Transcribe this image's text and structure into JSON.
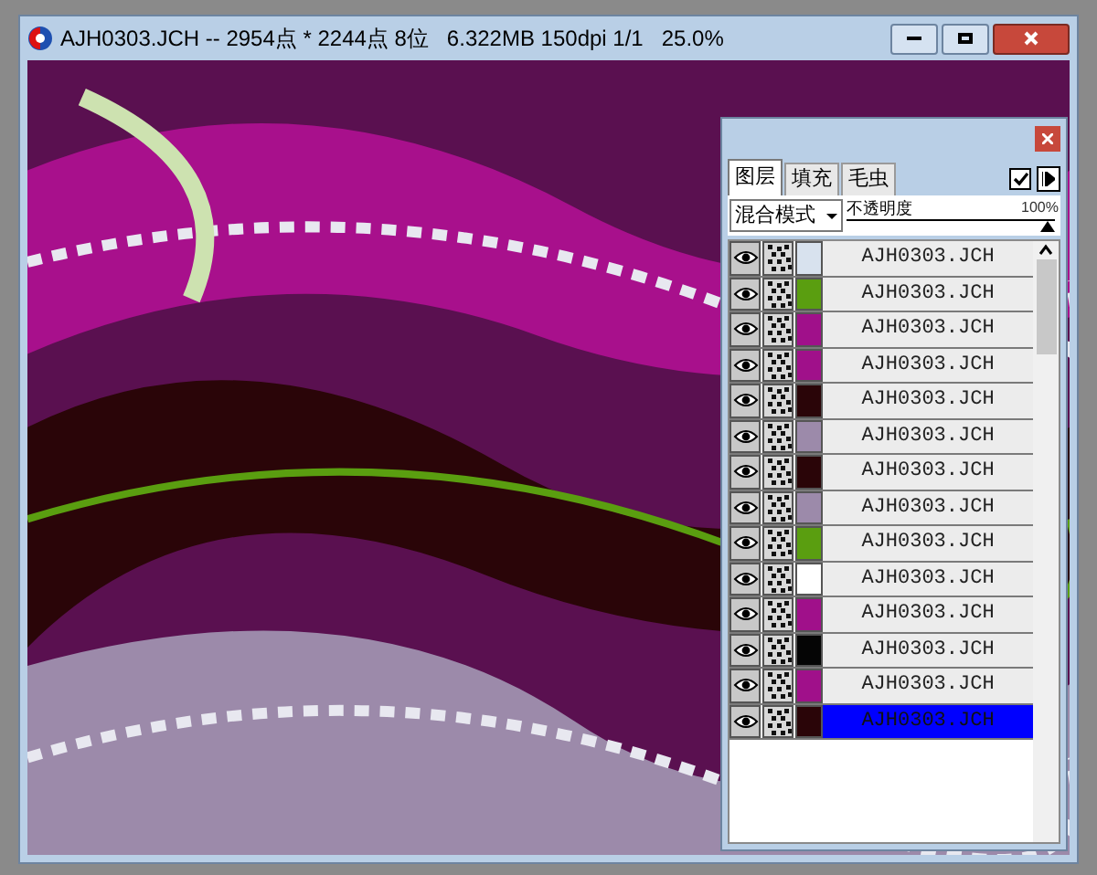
{
  "window": {
    "title": "AJH0303.JCH -- 2954点 * 2244点 8位   6.322MB 150dpi 1/1   25.0%"
  },
  "panel": {
    "tabs": [
      {
        "label": "图层",
        "selected": true
      },
      {
        "label": "填充",
        "selected": false
      },
      {
        "label": "毛虫",
        "selected": false
      }
    ],
    "lock_checked": true,
    "blend_mode": "混合模式",
    "opacity": {
      "label": "不透明度",
      "reading": "100%",
      "level": 1
    },
    "layers": [
      {
        "name": "AJH0303.JCH",
        "color": "#d8e2ee",
        "visible": true,
        "selected": false
      },
      {
        "name": "AJH0303.JCH",
        "color": "#5a9e10",
        "visible": true,
        "selected": false
      },
      {
        "name": "AJH0303.JCH",
        "color": "#a0108a",
        "visible": true,
        "selected": false
      },
      {
        "name": "AJH0303.JCH",
        "color": "#a0108a",
        "visible": true,
        "selected": false
      },
      {
        "name": "AJH0303.JCH",
        "color": "#2a0508",
        "visible": true,
        "selected": false
      },
      {
        "name": "AJH0303.JCH",
        "color": "#9c8aaa",
        "visible": true,
        "selected": false
      },
      {
        "name": "AJH0303.JCH",
        "color": "#2a0508",
        "visible": true,
        "selected": false
      },
      {
        "name": "AJH0303.JCH",
        "color": "#9c8aaa",
        "visible": true,
        "selected": false
      },
      {
        "name": "AJH0303.JCH",
        "color": "#5a9e10",
        "visible": true,
        "selected": false
      },
      {
        "name": "AJH0303.JCH",
        "color": "#ffffff",
        "visible": true,
        "selected": false
      },
      {
        "name": "AJH0303.JCH",
        "color": "#a0108a",
        "visible": true,
        "selected": false
      },
      {
        "name": "AJH0303.JCH",
        "color": "#050505",
        "visible": true,
        "selected": false
      },
      {
        "name": "AJH0303.JCH",
        "color": "#a0108a",
        "visible": true,
        "selected": false
      },
      {
        "name": "AJH0303.JCH",
        "color": "#2a0508",
        "visible": true,
        "selected": true
      }
    ]
  }
}
